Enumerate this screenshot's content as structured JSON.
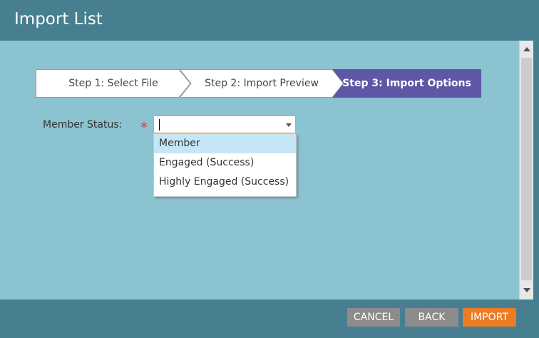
{
  "dialog": {
    "title": "Import List"
  },
  "steps": [
    {
      "label": "Step 1: Select File",
      "active": false
    },
    {
      "label": "Step 2: Import Preview",
      "active": false
    },
    {
      "label": "Step 3: Import Options",
      "active": true
    }
  ],
  "form": {
    "member_status_label": "Member Status:",
    "required_marker": "*",
    "member_status_value": "",
    "options": [
      "Member",
      "Engaged (Success)",
      "Highly Engaged (Success)"
    ],
    "highlighted_option": "Member"
  },
  "footer": {
    "cancel_label": "CANCEL",
    "back_label": "BACK",
    "import_label": "IMPORT"
  },
  "colors": {
    "titlebar": "#477f90",
    "body": "#8bc3d0",
    "active_step": "#5e57a6",
    "import_button": "#ea7c24",
    "secondary_button": "#8c8c8c",
    "required": "#c0504d"
  }
}
